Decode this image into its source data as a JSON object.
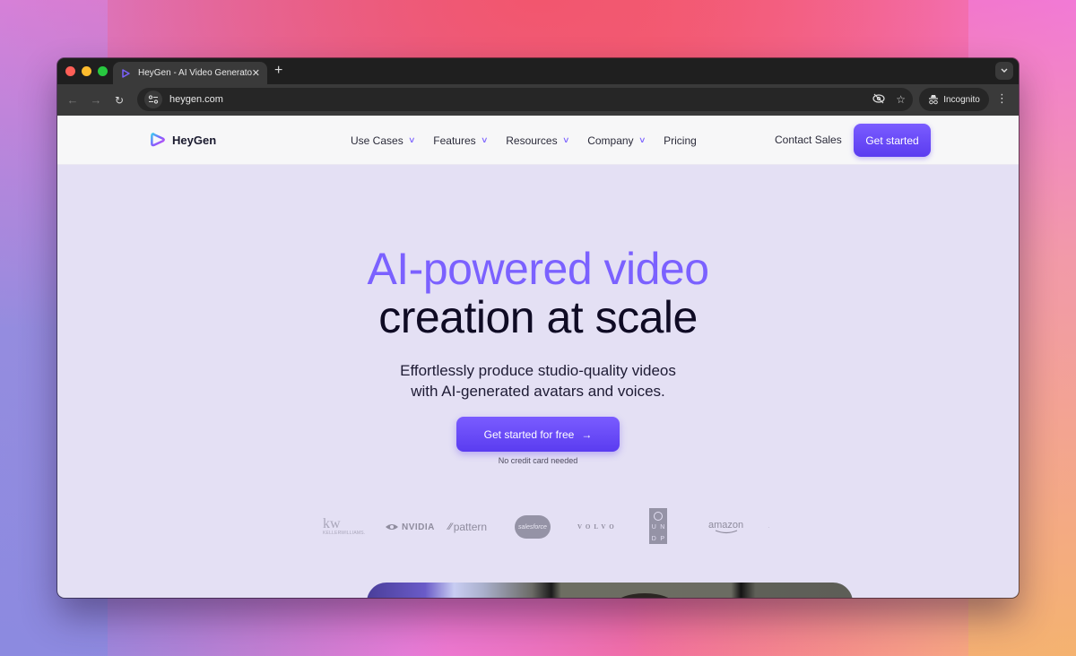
{
  "browser": {
    "tab_title": "HeyGen - AI Video Generator",
    "url": "heygen.com",
    "profile_label": "Incognito",
    "icons": {
      "back": "arrow-left-icon",
      "forward": "arrow-right-icon",
      "reload": "reload-icon",
      "site_info": "site-settings-icon",
      "tracking": "eye-off-icon",
      "bookmark": "star-icon",
      "incognito": "incognito-icon",
      "menu": "kebab-icon",
      "new_tab": "plus-icon",
      "close_tab": "close-icon",
      "tab_search": "chevron-down-icon"
    }
  },
  "header": {
    "brand": "HeyGen",
    "nav": [
      {
        "label": "Use Cases",
        "has_dropdown": true
      },
      {
        "label": "Features",
        "has_dropdown": true
      },
      {
        "label": "Resources",
        "has_dropdown": true
      },
      {
        "label": "Company",
        "has_dropdown": true
      },
      {
        "label": "Pricing",
        "has_dropdown": false
      }
    ],
    "contact_label": "Contact Sales",
    "cta_label": "Get started"
  },
  "hero": {
    "headline_accent": "AI-powered video",
    "headline_main": "creation at scale",
    "subheadline_line1": "Effortlessly produce studio-quality videos",
    "subheadline_line2": "with AI-generated avatars and voices.",
    "cta_label": "Get started for free",
    "cta_arrow": "→",
    "note": "No credit card needed"
  },
  "logos": [
    "Keller Williams",
    "NVIDIA",
    "pattern",
    "salesforce",
    "VOLVO",
    "UNDP",
    "amazon"
  ],
  "logo_text": {
    "kw": "kw",
    "kw_sub": "KELLERWILLIAMS.",
    "nvidia": "NVIDIA",
    "pattern": "pattern",
    "salesforce": "salesforce",
    "volvo": "VOLVO",
    "undp": [
      "U",
      "N",
      "D",
      "P"
    ],
    "amazon": "amazon"
  },
  "colors": {
    "accent": "#7b61ff",
    "cta": "#5b3cf0",
    "hero_bg": "#e4e0f4",
    "heading_dark": "#0f0b24"
  }
}
